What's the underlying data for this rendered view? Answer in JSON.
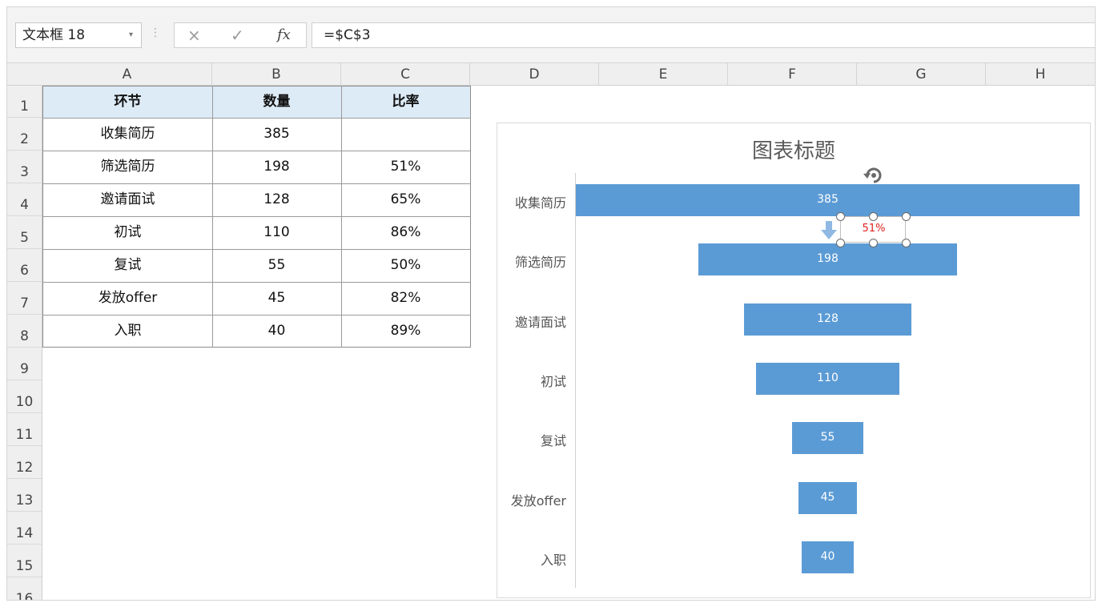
{
  "formula_bar": {
    "name_box": "文本框 18",
    "cancel_icon": "×",
    "enter_icon": "✓",
    "fx_label": "fx",
    "formula": "=$C$3"
  },
  "columns": [
    "A",
    "B",
    "C",
    "D",
    "E",
    "F",
    "G",
    "H"
  ],
  "rows": [
    "1",
    "2",
    "3",
    "4",
    "5",
    "6",
    "7",
    "8",
    "9",
    "10",
    "11",
    "12",
    "13",
    "14",
    "15",
    "16"
  ],
  "table": {
    "headers": [
      "环节",
      "数量",
      "比率"
    ],
    "rows": [
      [
        "收集简历",
        "385",
        ""
      ],
      [
        "筛选简历",
        "198",
        "51%"
      ],
      [
        "邀请面试",
        "128",
        "65%"
      ],
      [
        "初试",
        "110",
        "86%"
      ],
      [
        "复试",
        "55",
        "50%"
      ],
      [
        "发放offer",
        "45",
        "82%"
      ],
      [
        "入职",
        "40",
        "89%"
      ]
    ]
  },
  "chart": {
    "title": "图表标题",
    "selected_label": "51%"
  },
  "chart_data": {
    "type": "bar",
    "orientation": "horizontal",
    "style": "funnel-centered",
    "categories": [
      "收集简历",
      "筛选简历",
      "邀请面试",
      "初试",
      "复试",
      "发放offer",
      "入职"
    ],
    "values": [
      385,
      198,
      128,
      110,
      55,
      45,
      40
    ],
    "title": "图表标题",
    "xlabel": "",
    "ylabel": "",
    "data_labels": [
      "385",
      "198",
      "128",
      "110",
      "55",
      "45",
      "40"
    ],
    "bar_color": "#5b9bd5",
    "grid": false,
    "legend": "none"
  },
  "colors": {
    "header_fill": "#ddebf7",
    "bar": "#5b9bd5",
    "selection_text": "#e02020"
  }
}
